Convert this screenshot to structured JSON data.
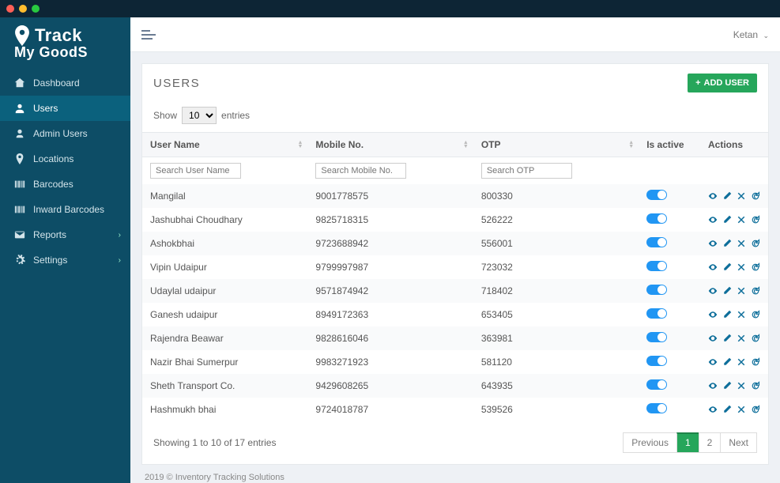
{
  "brand": {
    "line1": "Track",
    "line2": "My GoodS"
  },
  "sidebar": {
    "items": [
      {
        "label": "Dashboard",
        "icon": "home"
      },
      {
        "label": "Users",
        "icon": "users",
        "active": true
      },
      {
        "label": "Admin Users",
        "icon": "admin"
      },
      {
        "label": "Locations",
        "icon": "pin"
      },
      {
        "label": "Barcodes",
        "icon": "barcode"
      },
      {
        "label": "Inward Barcodes",
        "icon": "barcode"
      },
      {
        "label": "Reports",
        "icon": "mail",
        "expandable": true
      },
      {
        "label": "Settings",
        "icon": "gear",
        "expandable": true
      }
    ]
  },
  "topbar": {
    "username": "Ketan"
  },
  "page": {
    "title": "USERS",
    "add_user_label": "ADD USER",
    "length_show": "Show",
    "length_entries": "entries",
    "length_value": "10",
    "columns": {
      "user_name": "User Name",
      "mobile": "Mobile No.",
      "otp": "OTP",
      "is_active": "Is active",
      "actions": "Actions"
    },
    "filters": {
      "user_name_ph": "Search User Name",
      "mobile_ph": "Search Mobile No.",
      "otp_ph": "Search OTP"
    },
    "rows": [
      {
        "name": "Mangilal",
        "mobile": "9001778575",
        "otp": "800330",
        "active": true
      },
      {
        "name": "Jashubhai Choudhary",
        "mobile": "9825718315",
        "otp": "526222",
        "active": true
      },
      {
        "name": "Ashokbhai",
        "mobile": "9723688942",
        "otp": "556001",
        "active": true
      },
      {
        "name": "Vipin Udaipur",
        "mobile": "9799997987",
        "otp": "723032",
        "active": true
      },
      {
        "name": "Udaylal udaipur",
        "mobile": "9571874942",
        "otp": "718402",
        "active": true
      },
      {
        "name": "Ganesh udaipur",
        "mobile": "8949172363",
        "otp": "653405",
        "active": true
      },
      {
        "name": "Rajendra Beawar",
        "mobile": "9828616046",
        "otp": "363981",
        "active": true
      },
      {
        "name": "Nazir Bhai Sumerpur",
        "mobile": "9983271923",
        "otp": "581120",
        "active": true
      },
      {
        "name": "Sheth Transport Co.",
        "mobile": "9429608265",
        "otp": "643935",
        "active": true
      },
      {
        "name": "Hashmukh bhai",
        "mobile": "9724018787",
        "otp": "539526",
        "active": true
      }
    ],
    "info": "Showing 1 to 10 of 17 entries",
    "pager": {
      "prev": "Previous",
      "pages": [
        "1",
        "2"
      ],
      "next": "Next",
      "current": "1"
    }
  },
  "footer": "2019 © Inventory Tracking Solutions"
}
